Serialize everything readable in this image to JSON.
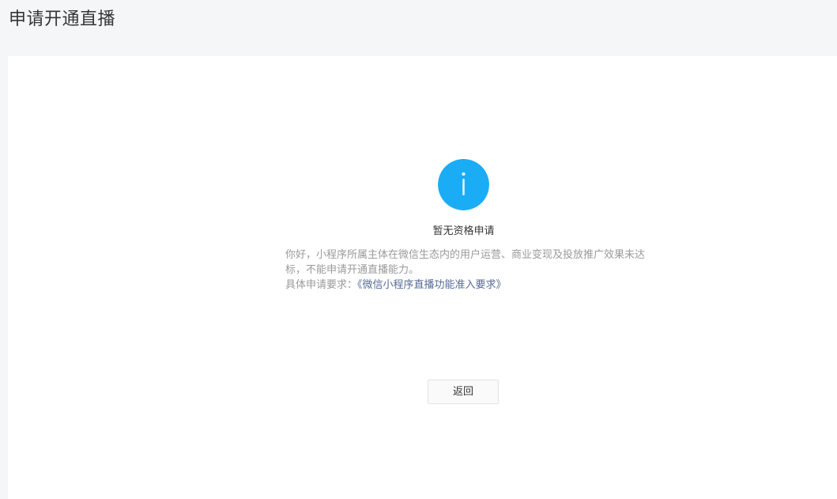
{
  "header": {
    "title": "申请开通直播"
  },
  "result": {
    "icon": "info-icon",
    "icon_color": "#1aadf5",
    "title": "暂无资格申请",
    "desc_line1": "你好，小程序所属主体在微信生态内的用户运营、商业变现及投放推广效果未达标，不能申请开通直播能力。",
    "requirement_label": "具体申请要求：",
    "requirement_link": "《微信小程序直播功能准入要求》",
    "back_label": "返回"
  },
  "colors": {
    "link": "#576b95",
    "desc": "#9a9a9a",
    "background": "#f5f6f7"
  }
}
